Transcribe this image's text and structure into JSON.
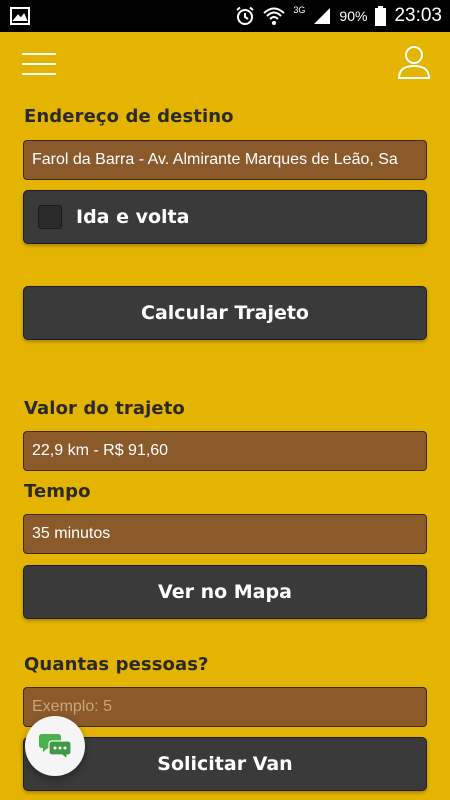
{
  "status_bar": {
    "network": "3G",
    "battery_percent": "90%",
    "time": "23:03"
  },
  "form": {
    "destination_label": "Endereço de destino",
    "destination_value": "Farol da Barra - Av. Almirante Marques de Leão, Sa",
    "round_trip_label": "Ida e volta",
    "round_trip_checked": false,
    "calc_button": "Calcular Trajeto",
    "route_value_label": "Valor do trajeto",
    "route_value": "22,9 km - R$ 91,60",
    "time_label": "Tempo",
    "time_value": "35 minutos",
    "map_button": "Ver no Mapa",
    "people_label": "Quantas pessoas?",
    "people_placeholder": "Exemplo: 5",
    "request_button": "Solicitar Van"
  },
  "colors": {
    "background": "#E5B400",
    "field": "#8A5A2B",
    "button": "#3A3A3A",
    "chat_icon": "#4CAF50"
  }
}
